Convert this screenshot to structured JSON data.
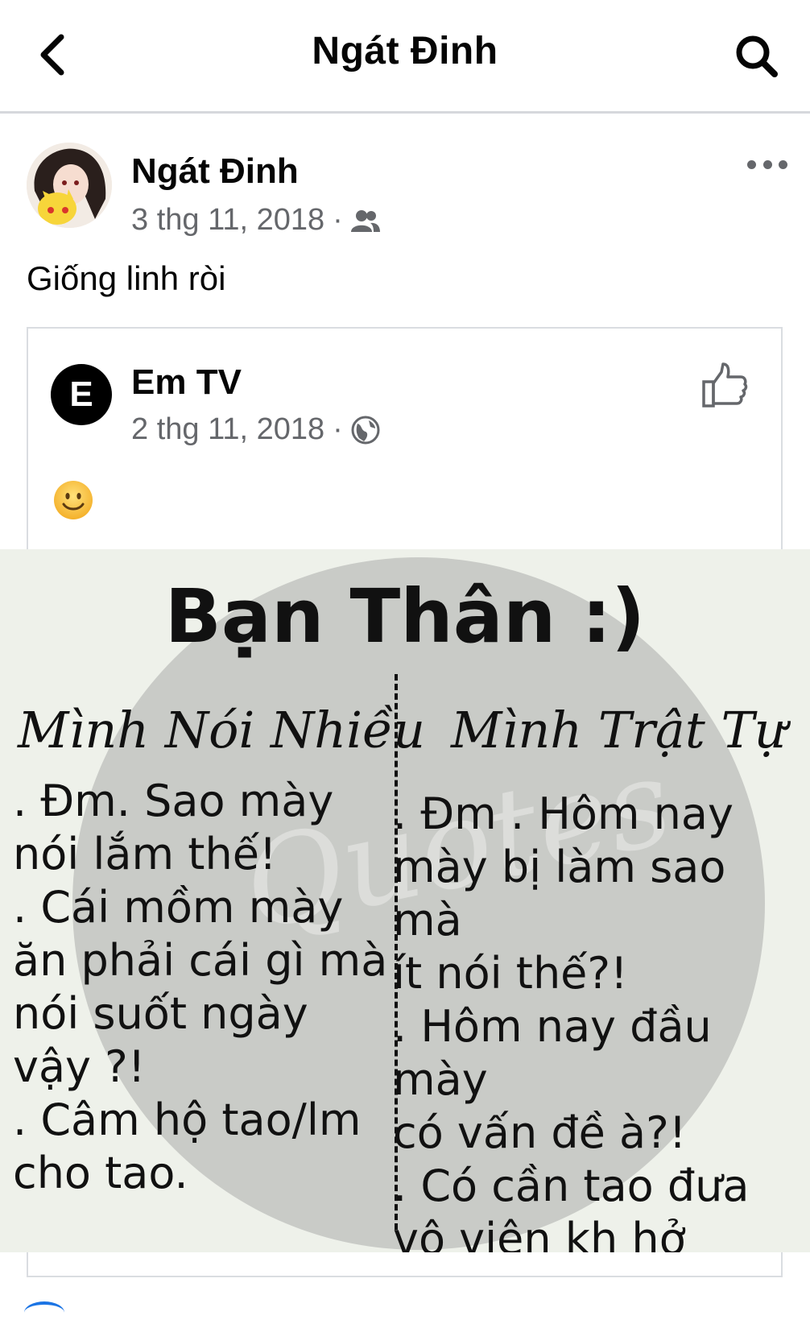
{
  "navbar": {
    "title": "Ngát Đinh"
  },
  "post": {
    "author": "Ngát Đinh",
    "date": "3 thg 11, 2018",
    "separator": "·",
    "audience_icon": "friends-icon",
    "text": "Giống linh ròi"
  },
  "shared_post": {
    "author": "Em TV",
    "avatar_letter": "E",
    "date": "2 thg 11, 2018",
    "separator": "·",
    "audience_icon": "globe-icon",
    "emoji": "smiling-face-emoji"
  },
  "image": {
    "heading": "Bạn Thân :)",
    "left_title": "Mình Nói Nhiều",
    "left_text": ". Đm. Sao mày\nnói lắm thế!\n. Cái mồm mày\năn phải cái gì mà\nnói suốt ngày\nvậy ?!\n. Câm hộ tao/lm\ncho tao.",
    "right_title": "Mình Trật Tự",
    "right_text": ". Đm . Hôm nay\nmày bị làm sao mà\nít nói thế?!\n. Hôm nay đầu mày\ncó vấn đề à?!\n. Có cần tao đưa\nvô viện kh hở\nmầy?!",
    "watermark": "Quotes"
  },
  "colors": {
    "text_primary": "#050505",
    "text_secondary": "#65676b",
    "divider": "#dadde1",
    "accent": "#1b74e4"
  }
}
